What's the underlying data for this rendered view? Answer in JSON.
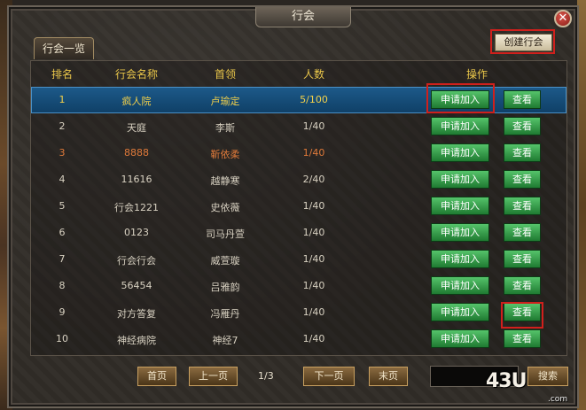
{
  "window": {
    "title": "行会",
    "close_glyph": "✕"
  },
  "tab": {
    "label": "行会一览"
  },
  "create_button": {
    "label": "创建行会"
  },
  "table": {
    "headers": {
      "rank": "排名",
      "name": "行会名称",
      "leader": "首领",
      "members": "人数",
      "actions": "操作"
    },
    "join_label": "申请加入",
    "view_label": "查看",
    "rows": [
      {
        "rank": "1",
        "name": "疯人院",
        "leader": "卢瑜定",
        "members": "5/100",
        "style": "selected"
      },
      {
        "rank": "2",
        "name": "天庭",
        "leader": "李斯",
        "members": "1/40",
        "style": "normal"
      },
      {
        "rank": "3",
        "name": "8888",
        "leader": "靳依柔",
        "members": "1/40",
        "style": "orange"
      },
      {
        "rank": "4",
        "name": "11616",
        "leader": "越静寒",
        "members": "2/40",
        "style": "normal"
      },
      {
        "rank": "5",
        "name": "行会1221",
        "leader": "史依薇",
        "members": "1/40",
        "style": "normal"
      },
      {
        "rank": "6",
        "name": "0123",
        "leader": "司马丹萱",
        "members": "1/40",
        "style": "normal"
      },
      {
        "rank": "7",
        "name": "行会行会",
        "leader": "威萱璇",
        "members": "1/40",
        "style": "normal"
      },
      {
        "rank": "8",
        "name": "56454",
        "leader": "吕雅韵",
        "members": "1/40",
        "style": "normal"
      },
      {
        "rank": "9",
        "name": "对方答复",
        "leader": "冯雁丹",
        "members": "1/40",
        "style": "normal"
      },
      {
        "rank": "10",
        "name": "神经病院",
        "leader": "神经7",
        "members": "1/40",
        "style": "normal"
      }
    ]
  },
  "pager": {
    "first": "首页",
    "prev": "上一页",
    "page_indicator": "1/3",
    "next": "下一页",
    "last": "末页",
    "search": "搜索",
    "search_value": ""
  },
  "watermark": {
    "text": "43U",
    "sub": ".com"
  },
  "colors": {
    "accent_header": "#e9c64a",
    "selected_row": "#1d5a8a",
    "green_button": "#2f9a44",
    "highlight_box": "#d0201c"
  }
}
